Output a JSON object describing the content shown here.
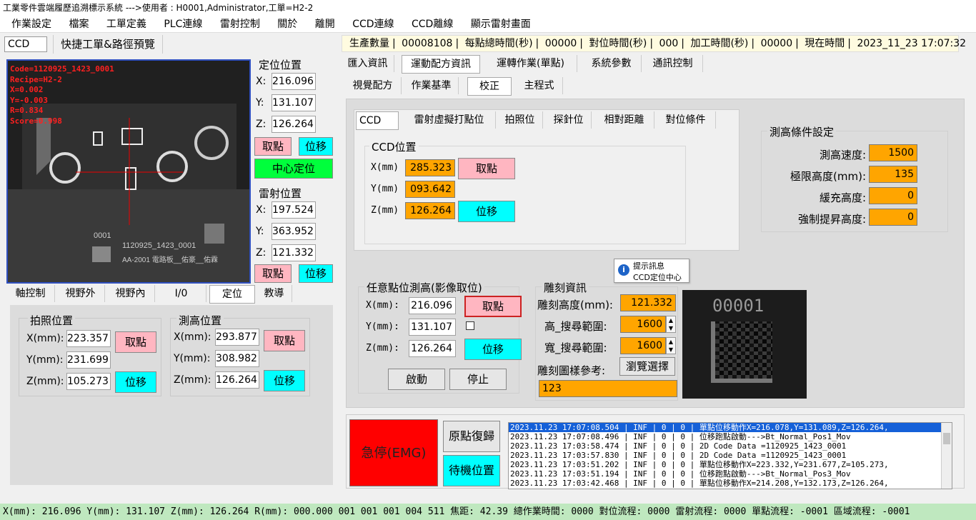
{
  "window": {
    "title": "工業零件雲端履歷追溯標示系統 --->使用者 : H0001,Administrator,工單=H2-2"
  },
  "menu": [
    "作業設定",
    "檔案",
    "工單定義",
    "PLC連線",
    "雷射控制",
    "關於",
    "離開",
    "CCD連線",
    "CCD離線",
    "顯示雷射畫面"
  ],
  "toolbar": {
    "ccd_label": "CCD",
    "preview_label": "快捷工單&路徑預覽"
  },
  "stats": {
    "prod_label": "生產數量",
    "prod_value": "00008108",
    "point_label": "每點總時間(秒)",
    "point_value": "00000",
    "align_label": "對位時間(秒)",
    "align_value": "000",
    "proc_label": "加工時間(秒)",
    "proc_value": "00000",
    "now_label": "現在時間",
    "now_value": "2023_11_23  17:07:32"
  },
  "camera": {
    "overlay": [
      "Code=1120925_1423_0001",
      "Recipe=H2-2",
      "X=0.002",
      "Y=-0.003",
      "R=0.834",
      "Score=0.998"
    ],
    "board_label_1": "0001",
    "board_label_2": "1120925_1423_0001",
    "board_label_3": "AA-2001  電路板__佑豪__佑霖"
  },
  "locate": {
    "title": "定位位置",
    "x_label": "X:",
    "x": "216.096",
    "y_label": "Y:",
    "y": "131.107",
    "z_label": "Z:",
    "z": "126.264",
    "take_label": "取點",
    "move_label": "位移",
    "center_label": "中心定位"
  },
  "laser": {
    "title": "雷射位置",
    "x_label": "X:",
    "x": "197.524",
    "y_label": "Y:",
    "y": "363.952",
    "z_label": "Z:",
    "z": "121.332",
    "take_label": "取點",
    "move_label": "位移"
  },
  "left_tabs": [
    "軸控制",
    "視野外",
    "視野內",
    "I/0",
    "定位",
    "教導"
  ],
  "photo_pos": {
    "title": "拍照位置",
    "x_label": "X(mm):",
    "x": "223.357",
    "y_label": "Y(mm):",
    "y": "231.699",
    "z_label": "Z(mm):",
    "z": "105.273",
    "take_label": "取點",
    "move_label": "位移"
  },
  "measure_pos": {
    "title": "測高位置",
    "x_label": "X(mm):",
    "x": "293.877",
    "y_label": "Y(mm):",
    "y": "308.982",
    "z_label": "Z(mm):",
    "z": "126.264",
    "take_label": "取點",
    "move_label": "位移"
  },
  "main_tabs": [
    "匯入資訊",
    "運動配方資訊",
    "運轉作業(單點)",
    "系統參數",
    "通訊控制"
  ],
  "sub_tabs": [
    "視覺配方",
    "作業基準",
    "校正",
    "主程式"
  ],
  "inner_tabs": [
    "CCD",
    "雷射虛擬打點位",
    "拍照位",
    "探針位",
    "相對距離",
    "對位條件"
  ],
  "ccd_pos": {
    "title": "CCD位置",
    "x_label": "X(mm)",
    "x": "285.323",
    "y_label": "Y(mm)",
    "y": "093.642",
    "z_label": "Z(mm)",
    "z": "126.264",
    "take_label": "取點",
    "move_label": "位移"
  },
  "height_cond": {
    "title": "測高條件設定",
    "speed_label": "測高速度:",
    "speed": "1500",
    "limit_label": "極限高度(mm):",
    "limit": "135",
    "buffer_label": "緩充高度:",
    "buffer": "0",
    "force_label": "強制提昇高度:",
    "force": "0"
  },
  "arbitrary": {
    "title": "任意點位測高(影像取位)",
    "x_label": "X(mm):",
    "x": "216.096",
    "y_label": "Y(mm):",
    "y": "131.107",
    "z_label": "Z(mm):",
    "z": "126.264",
    "take_label": "取點",
    "move_label": "位移",
    "start_label": "啟動",
    "stop_label": "停止"
  },
  "engrave": {
    "title": "雕刻資訊",
    "height_label": "雕刻高度(mm):",
    "height": "121.332",
    "h_range_label": "高_搜尋範圍:",
    "h_range": "1600",
    "w_range_label": "寬_搜尋範圍:",
    "w_range": "1600",
    "pattern_label": "雕刻圖樣參考:",
    "browse_label": "瀏覽選擇",
    "pattern_value": "123",
    "preview_text": "00001"
  },
  "tooltip": {
    "title": "提示訊息",
    "text": "CCD定位中心"
  },
  "controls": {
    "emg_label": "急停(EMG)",
    "home_label": "原點復歸",
    "standby_label": "待機位置"
  },
  "log": [
    "2023.11.23 17:07:08.504 | INF | 0 | 0 | 單點位移動作X=216.078,Y=131.089,Z=126.264,",
    "2023.11.23 17:07:08.496 | INF | 0 | 0 | 位移跑點啟動--->Bt_Normal_Pos1_Mov",
    "2023.11.23 17:03:58.474 | INF | 0 | 0 | 2D Code Data =1120925_1423_0001",
    "2023.11.23 17:03:57.830 | INF | 0 | 0 | 2D Code Data =1120925_1423_0001",
    "2023.11.23 17:03:51.202 | INF | 0 | 0 | 單點位移動作X=223.332,Y=231.677,Z=105.273,",
    "2023.11.23 17:03:51.194 | INF | 0 | 0 | 位移跑點啟動--->Bt_Normal_Pos3_Mov",
    "2023.11.23 17:03:42.468 | INF | 0 | 0 | 單點位移動作X=214.208,Y=132.173,Z=126.264,"
  ],
  "status": "X(mm): 216.096 Y(mm): 131.107 Z(mm): 126.264 R(mm): 000.000 001 001 001 004 511 焦距: 42.39 總作業時間: 0000 對位流程: 0000 雷射流程: 0000 單點流程: -0001 區域流程: -0001"
}
